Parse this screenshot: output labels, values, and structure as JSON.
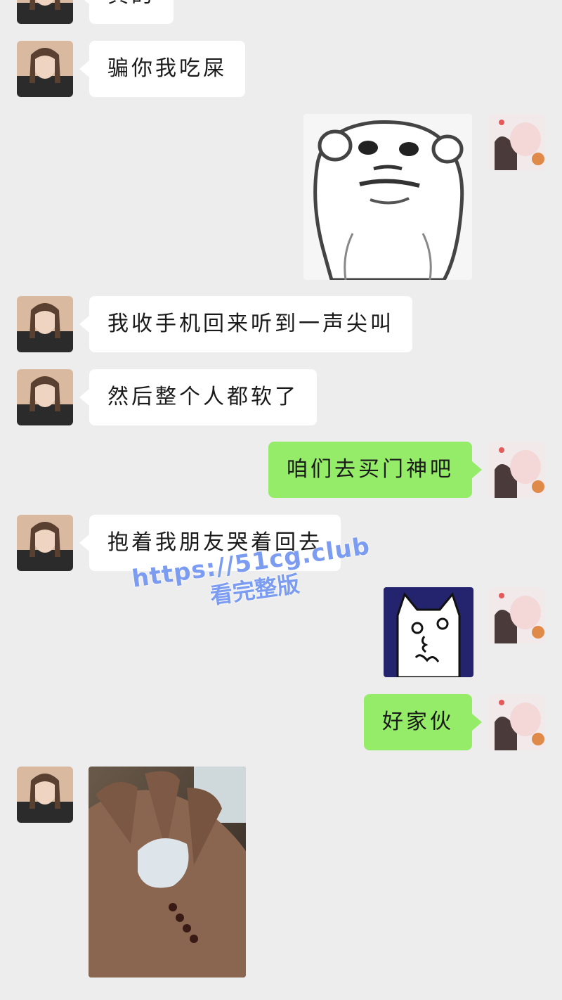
{
  "colors": {
    "background": "#ededed",
    "incoming_bubble": "#ffffff",
    "outgoing_bubble": "#95ec69",
    "watermark": "#7b9cf0"
  },
  "messages": [
    {
      "side": "left",
      "type": "text",
      "text": "真的"
    },
    {
      "side": "left",
      "type": "text",
      "text": "骗你我吃屎"
    },
    {
      "side": "right",
      "type": "image",
      "image": "panda-meme-sticker"
    },
    {
      "side": "left",
      "type": "text",
      "text": "我收手机回来听到一声尖叫"
    },
    {
      "side": "left",
      "type": "text",
      "text": "然后整个人都软了"
    },
    {
      "side": "right",
      "type": "text",
      "text": "咱们去买门神吧"
    },
    {
      "side": "left",
      "type": "text",
      "text": "抱着我朋友哭着回去"
    },
    {
      "side": "right",
      "type": "image",
      "image": "cartoon-cat-sticker"
    },
    {
      "side": "right",
      "type": "text",
      "text": "好家伙"
    },
    {
      "side": "left",
      "type": "image",
      "image": "hand-holding-jade-photo"
    }
  ],
  "watermark": {
    "url": "https://51cg.club",
    "subtitle": "看完整版"
  }
}
